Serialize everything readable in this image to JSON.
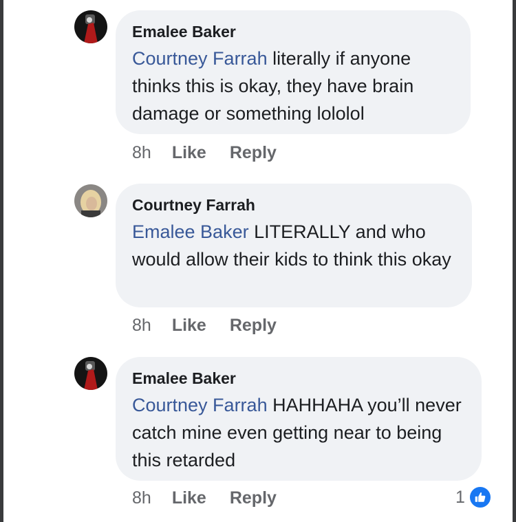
{
  "comments": [
    {
      "author": "Emalee Baker",
      "mention": "Courtney Farrah",
      "text": " literally if anyone thinks this is okay, they have brain damage or something lololol",
      "time": "8h",
      "like_label": "Like",
      "reply_label": "Reply"
    },
    {
      "author": "Courtney Farrah",
      "mention": "Emalee Baker",
      "text": " LITERALLY and who would allow their kids to think this okay",
      "time": "8h",
      "like_label": "Like",
      "reply_label": "Reply"
    },
    {
      "author": "Emalee Baker",
      "mention": "Courtney Farrah",
      "text": " HAHHAHA you’ll never catch mine even getting near to being this retarded",
      "time": "8h",
      "like_label": "Like",
      "reply_label": "Reply",
      "reaction_count": "1",
      "reaction_icon": "thumbs-up-icon"
    }
  ],
  "colors": {
    "mention": "#385898",
    "bubble": "#f0f2f5",
    "meta": "#65676b",
    "reaction": "#1877f2"
  }
}
